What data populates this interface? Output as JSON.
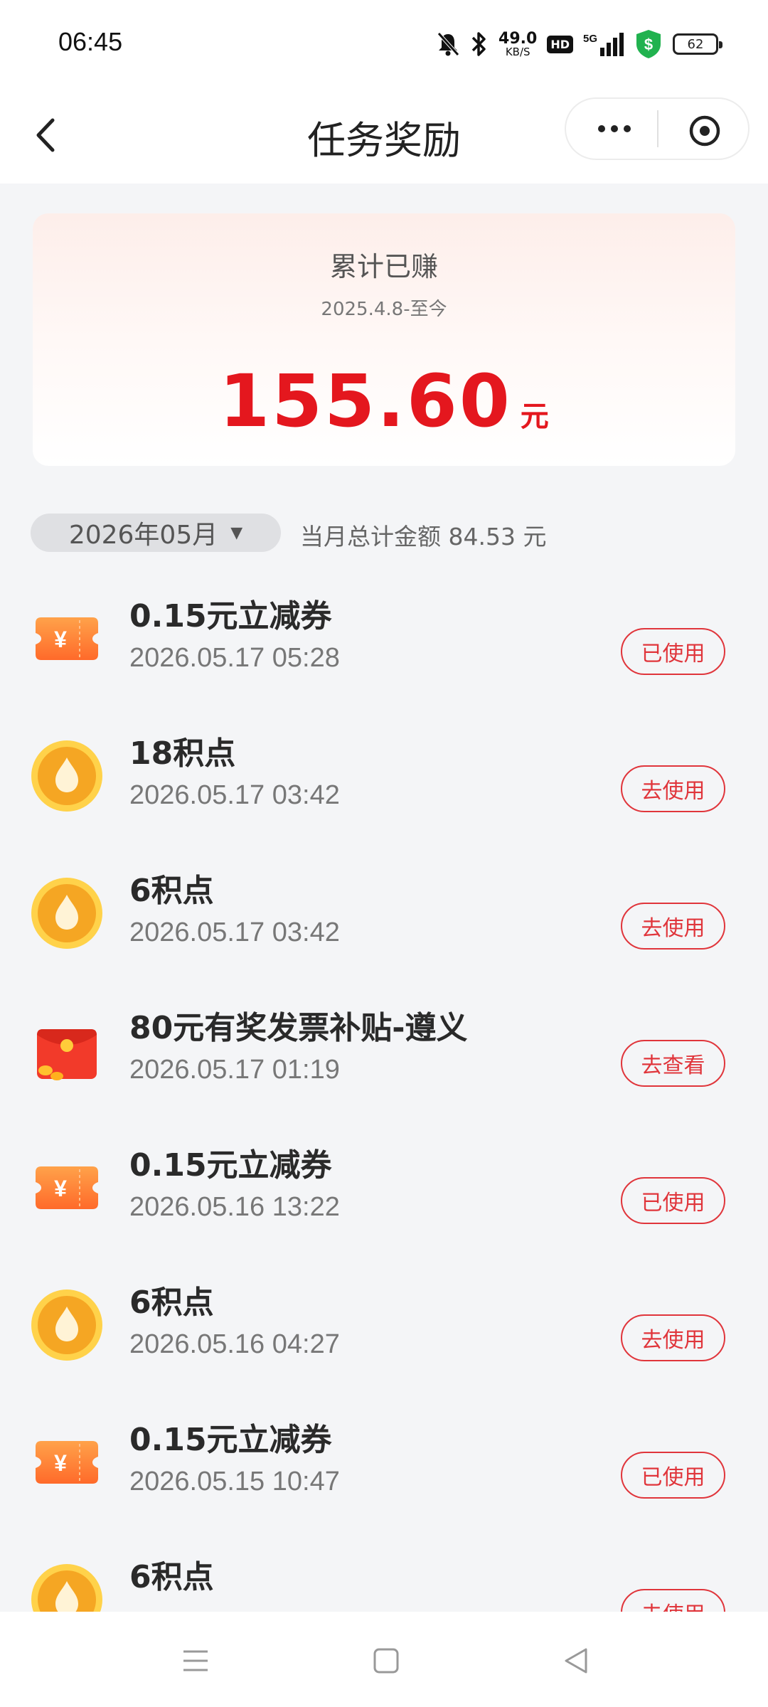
{
  "status_bar": {
    "time": "06:45",
    "net_speed_value": "49.0",
    "net_speed_unit": "KB/S",
    "hd": "HD",
    "signal": "5G",
    "battery": "62"
  },
  "nav": {
    "title": "任务奖励"
  },
  "summary": {
    "title": "累计已赚",
    "range": "2025.4.8-至今",
    "amount": "155.60",
    "unit": "元"
  },
  "filter": {
    "month": "2026年05月",
    "total_text": "当月总计金额 84.53 元"
  },
  "rewards": [
    {
      "name": "0.15元立减券",
      "time": "2026.05.17 05:28",
      "action": "已使用",
      "icon": "coupon-icon"
    },
    {
      "name": "18积点",
      "time": "2026.05.17 03:42",
      "action": "去使用",
      "icon": "points-drop-icon"
    },
    {
      "name": "6积点",
      "time": "2026.05.17 03:42",
      "action": "去使用",
      "icon": "points-drop-icon"
    },
    {
      "name": "80元有奖发票补贴-遵义",
      "time": "2026.05.17 01:19",
      "action": "去查看",
      "icon": "red-envelope-icon"
    },
    {
      "name": "0.15元立减券",
      "time": "2026.05.16 13:22",
      "action": "已使用",
      "icon": "coupon-icon"
    },
    {
      "name": "6积点",
      "time": "2026.05.16 04:27",
      "action": "去使用",
      "icon": "points-drop-icon"
    },
    {
      "name": "0.15元立减券",
      "time": "2026.05.15 10:47",
      "action": "已使用",
      "icon": "coupon-icon"
    },
    {
      "name": "6积点",
      "time": "",
      "action": "去使用",
      "icon": "points-drop-icon"
    }
  ],
  "colors": {
    "accent_red": "#e4171e",
    "button_red": "#e0353b",
    "background": "#f4f5f7"
  }
}
